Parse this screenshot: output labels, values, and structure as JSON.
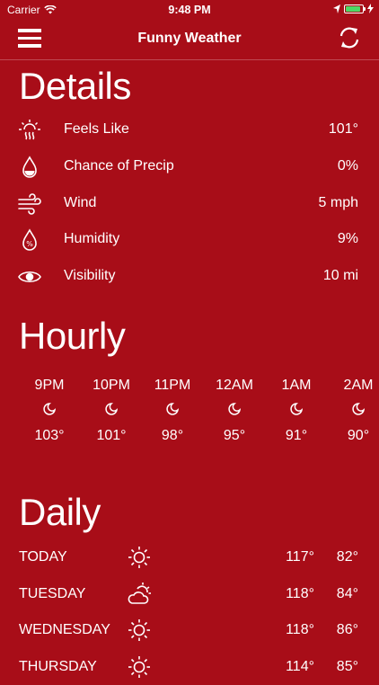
{
  "status_bar": {
    "carrier": "Carrier",
    "time": "9:48 PM"
  },
  "navbar": {
    "title": "Funny Weather"
  },
  "details": {
    "title": "Details",
    "rows": [
      {
        "label": "Feels Like",
        "value": "101°",
        "icon": "heat-icon"
      },
      {
        "label": "Chance of Precip",
        "value": "0%",
        "icon": "drop-icon"
      },
      {
        "label": "Wind",
        "value": "5 mph",
        "icon": "wind-icon"
      },
      {
        "label": "Humidity",
        "value": "9%",
        "icon": "humidity-icon"
      },
      {
        "label": "Visibility",
        "value": "10 mi",
        "icon": "eye-icon"
      }
    ]
  },
  "hourly": {
    "title": "Hourly",
    "items": [
      {
        "hour": "9PM",
        "temp": "103°",
        "icon": "moon-icon"
      },
      {
        "hour": "10PM",
        "temp": "101°",
        "icon": "moon-icon"
      },
      {
        "hour": "11PM",
        "temp": "98°",
        "icon": "moon-icon"
      },
      {
        "hour": "12AM",
        "temp": "95°",
        "icon": "moon-icon"
      },
      {
        "hour": "1AM",
        "temp": "91°",
        "icon": "moon-icon"
      },
      {
        "hour": "2AM",
        "temp": "90°",
        "icon": "moon-icon"
      }
    ]
  },
  "daily": {
    "title": "Daily",
    "days": [
      {
        "day": "TODAY",
        "high": "117°",
        "low": "82°",
        "icon": "sun-icon"
      },
      {
        "day": "TUESDAY",
        "high": "118°",
        "low": "84°",
        "icon": "partly-cloudy-icon"
      },
      {
        "day": "WEDNESDAY",
        "high": "118°",
        "low": "86°",
        "icon": "sun-icon"
      },
      {
        "day": "THURSDAY",
        "high": "114°",
        "low": "85°",
        "icon": "sun-icon"
      }
    ]
  },
  "colors": {
    "background": "#A80D18",
    "text": "#FFFFFF",
    "battery": "#4CD964"
  }
}
